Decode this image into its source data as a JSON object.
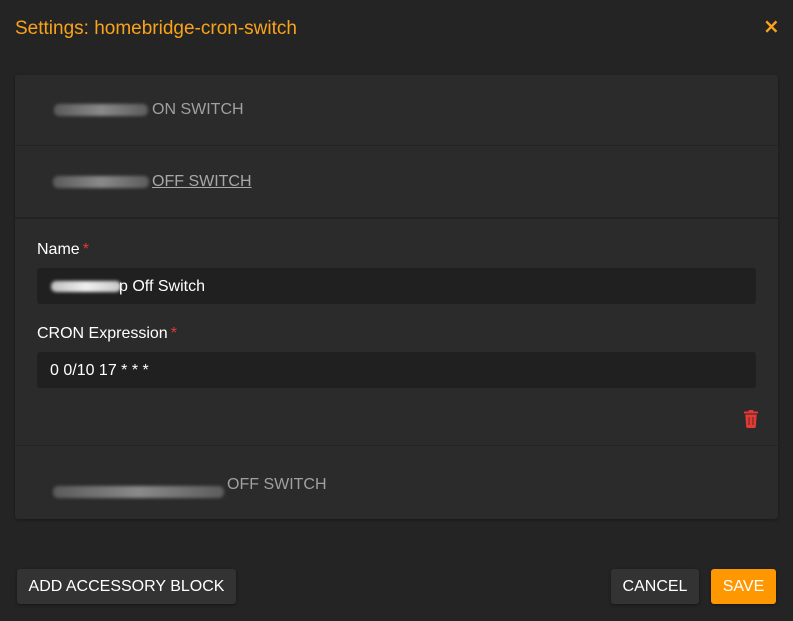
{
  "modal": {
    "title": "Settings: homebridge-cron-switch",
    "close_glyph": "×"
  },
  "accessories": [
    {
      "label": "ON SWITCH",
      "expanded": false
    },
    {
      "label": "OFF SWITCH",
      "expanded": true
    },
    {
      "label": "OFF SWITCH",
      "expanded": false
    }
  ],
  "form": {
    "name_label": "Name",
    "name_value": "p Off Switch",
    "cron_label": "CRON Expression",
    "cron_value": "0 0/10 17 * * *",
    "required_mark": "*"
  },
  "icons": {
    "delete": "trash-icon",
    "close": "close-icon"
  },
  "footer": {
    "add_label": "ADD ACCESSORY BLOCK",
    "cancel_label": "CANCEL",
    "save_label": "SAVE"
  },
  "colors": {
    "accent": "#f9a31b",
    "save": "#ff9800",
    "danger": "#e53935",
    "background": "#242424",
    "panel": "#2b2b2b"
  }
}
